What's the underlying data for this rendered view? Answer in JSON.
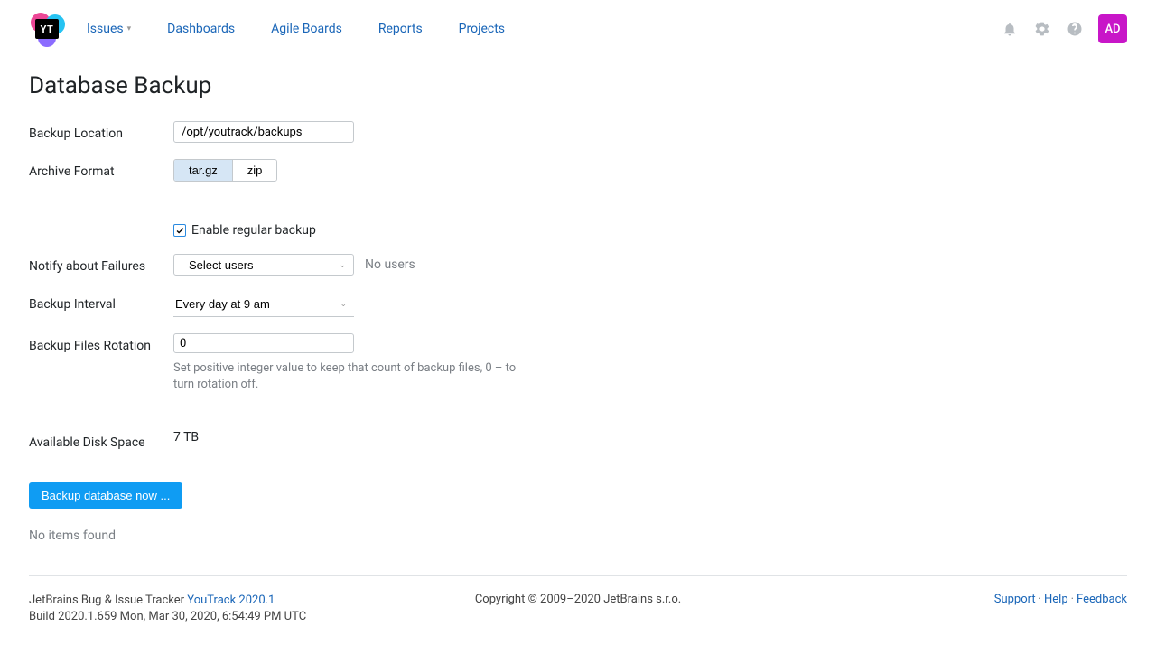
{
  "nav": {
    "issues": "Issues",
    "dashboards": "Dashboards",
    "agile": "Agile Boards",
    "reports": "Reports",
    "projects": "Projects"
  },
  "logo_text": "YT",
  "avatar": "AD",
  "page_title": "Database Backup",
  "labels": {
    "backup_location": "Backup Location",
    "archive_format": "Archive Format",
    "enable_regular": "Enable regular backup",
    "notify_failures": "Notify about Failures",
    "backup_interval": "Backup Interval",
    "rotation": "Backup Files Rotation",
    "disk_space": "Available Disk Space"
  },
  "values": {
    "backup_location": "/opt/youtrack/backups",
    "format_targz": "tar.gz",
    "format_zip": "zip",
    "select_users": "Select users",
    "no_users": "No users",
    "interval": "Every day at 9 am",
    "rotation": "0",
    "rotation_hint": "Set positive integer value to keep that count of backup files, 0 – to turn rotation off.",
    "disk_space": "7 TB"
  },
  "buttons": {
    "backup_now": "Backup database now ..."
  },
  "misc": {
    "no_items": "No items found"
  },
  "footer": {
    "product_prefix": "JetBrains Bug & Issue Tracker ",
    "product_link": "YouTrack 2020.1",
    "build": "Build 2020.1.659 Mon, Mar 30, 2020, 6:54:49 PM UTC",
    "copyright": "Copyright © 2009–2020 JetBrains s.r.o.",
    "support": "Support",
    "help": "Help",
    "feedback": "Feedback"
  }
}
